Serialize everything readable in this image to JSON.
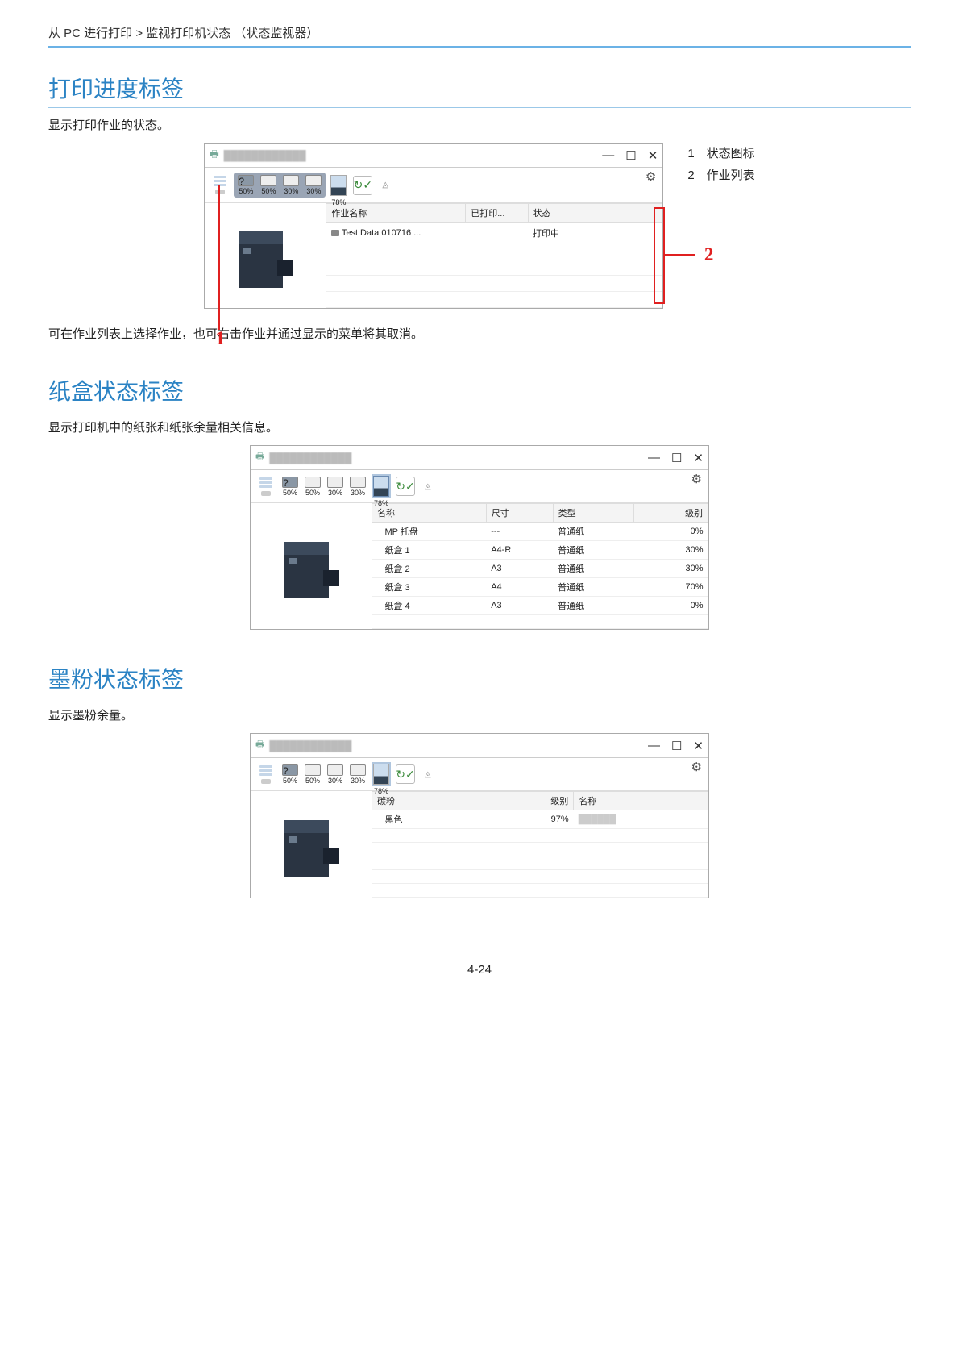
{
  "breadcrumb": "从 PC 进行打印 > 监视打印机状态 （状态监视器）",
  "sections": {
    "s1": {
      "title": "打印进度标签",
      "desc": "显示打印作业的状态。",
      "legend": {
        "l1": "1　状态图标",
        "l2": "2　作业列表"
      },
      "note": "可在作业列表上选择作业，也可右击作业并通过显示的菜单将其取消。",
      "window": {
        "toolbar_pcts": [
          "50%",
          "50%",
          "30%",
          "30%"
        ],
        "gauge": "78%",
        "table": {
          "headers": [
            "作业名称",
            "已打印...",
            "状态"
          ],
          "rows": [
            {
              "name": "Test Data 010716 ...",
              "printed": "",
              "status": "打印中"
            }
          ]
        }
      },
      "callout1": "1",
      "callout2": "2"
    },
    "s2": {
      "title": "纸盒状态标签",
      "desc": "显示打印机中的纸张和纸张余量相关信息。",
      "window": {
        "toolbar_pcts": [
          "50%",
          "50%",
          "30%",
          "30%"
        ],
        "gauge": "78%",
        "table": {
          "headers": [
            "名称",
            "尺寸",
            "类型",
            "级别"
          ],
          "rows": [
            {
              "name": "MP 托盘",
              "size": "---",
              "type": "普通纸",
              "level": "0%"
            },
            {
              "name": "纸盒 1",
              "size": "A4-R",
              "type": "普通纸",
              "level": "30%"
            },
            {
              "name": "纸盒 2",
              "size": "A3",
              "type": "普通纸",
              "level": "30%"
            },
            {
              "name": "纸盒 3",
              "size": "A4",
              "type": "普通纸",
              "level": "70%"
            },
            {
              "name": "纸盒 4",
              "size": "A3",
              "type": "普通纸",
              "level": "0%"
            }
          ]
        }
      }
    },
    "s3": {
      "title": "墨粉状态标签",
      "desc": "显示墨粉余量。",
      "window": {
        "toolbar_pcts": [
          "50%",
          "50%",
          "30%",
          "30%"
        ],
        "gauge": "78%",
        "table": {
          "headers": [
            "碳粉",
            "级别",
            "名称"
          ],
          "rows": [
            {
              "toner": "黑色",
              "level": "97%",
              "name": ""
            }
          ]
        }
      }
    }
  },
  "win_controls": {
    "min": "—",
    "max": "☐",
    "close": "✕"
  },
  "page_number": "4-24"
}
